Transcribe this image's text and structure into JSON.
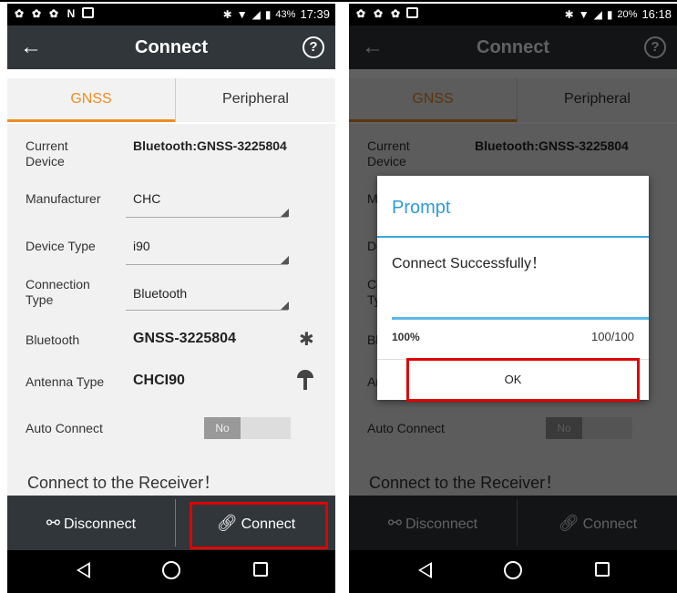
{
  "status_left": {
    "time": "17:39",
    "battery": "43%"
  },
  "status_right": {
    "time": "16:18",
    "battery": "20%"
  },
  "appbar": {
    "title": "Connect",
    "help": "?"
  },
  "tabs": [
    {
      "label": "GNSS"
    },
    {
      "label": "Peripheral"
    }
  ],
  "form": {
    "current_device_label": "Current Device",
    "current_device_value": "Bluetooth:GNSS-3225804",
    "manufacturer_label": "Manufacturer",
    "manufacturer_value": "CHC",
    "device_type_label": "Device Type",
    "device_type_value": "i90",
    "connection_type_label": "Connection Type",
    "connection_type_value": "Bluetooth",
    "bluetooth_label": "Bluetooth",
    "bluetooth_value": "GNSS-3225804",
    "antenna_type_label": "Antenna Type",
    "antenna_type_value": "CHCI90",
    "auto_connect_label": "Auto Connect",
    "auto_connect_value": "No"
  },
  "connect_message": "Connect to the Receiver！",
  "bottom": {
    "disconnect": "Disconnect",
    "connect": "Connect"
  },
  "dialog": {
    "title": "Prompt",
    "message": "Connect Successfully！",
    "progress_percent": "100%",
    "progress_count": "100/100",
    "progress_fraction": 1.0,
    "ok": "OK"
  },
  "colors": {
    "accent": "#ef8c22",
    "bar": "#31363b",
    "highlight": "#e00000",
    "dialog_accent": "#39a7e0"
  },
  "icons": [
    "back-arrow-icon",
    "help-icon",
    "bluetooth-icon",
    "antenna-icon",
    "link-icon",
    "broken-link-icon",
    "nav-back-icon",
    "nav-home-icon",
    "nav-recent-icon"
  ]
}
